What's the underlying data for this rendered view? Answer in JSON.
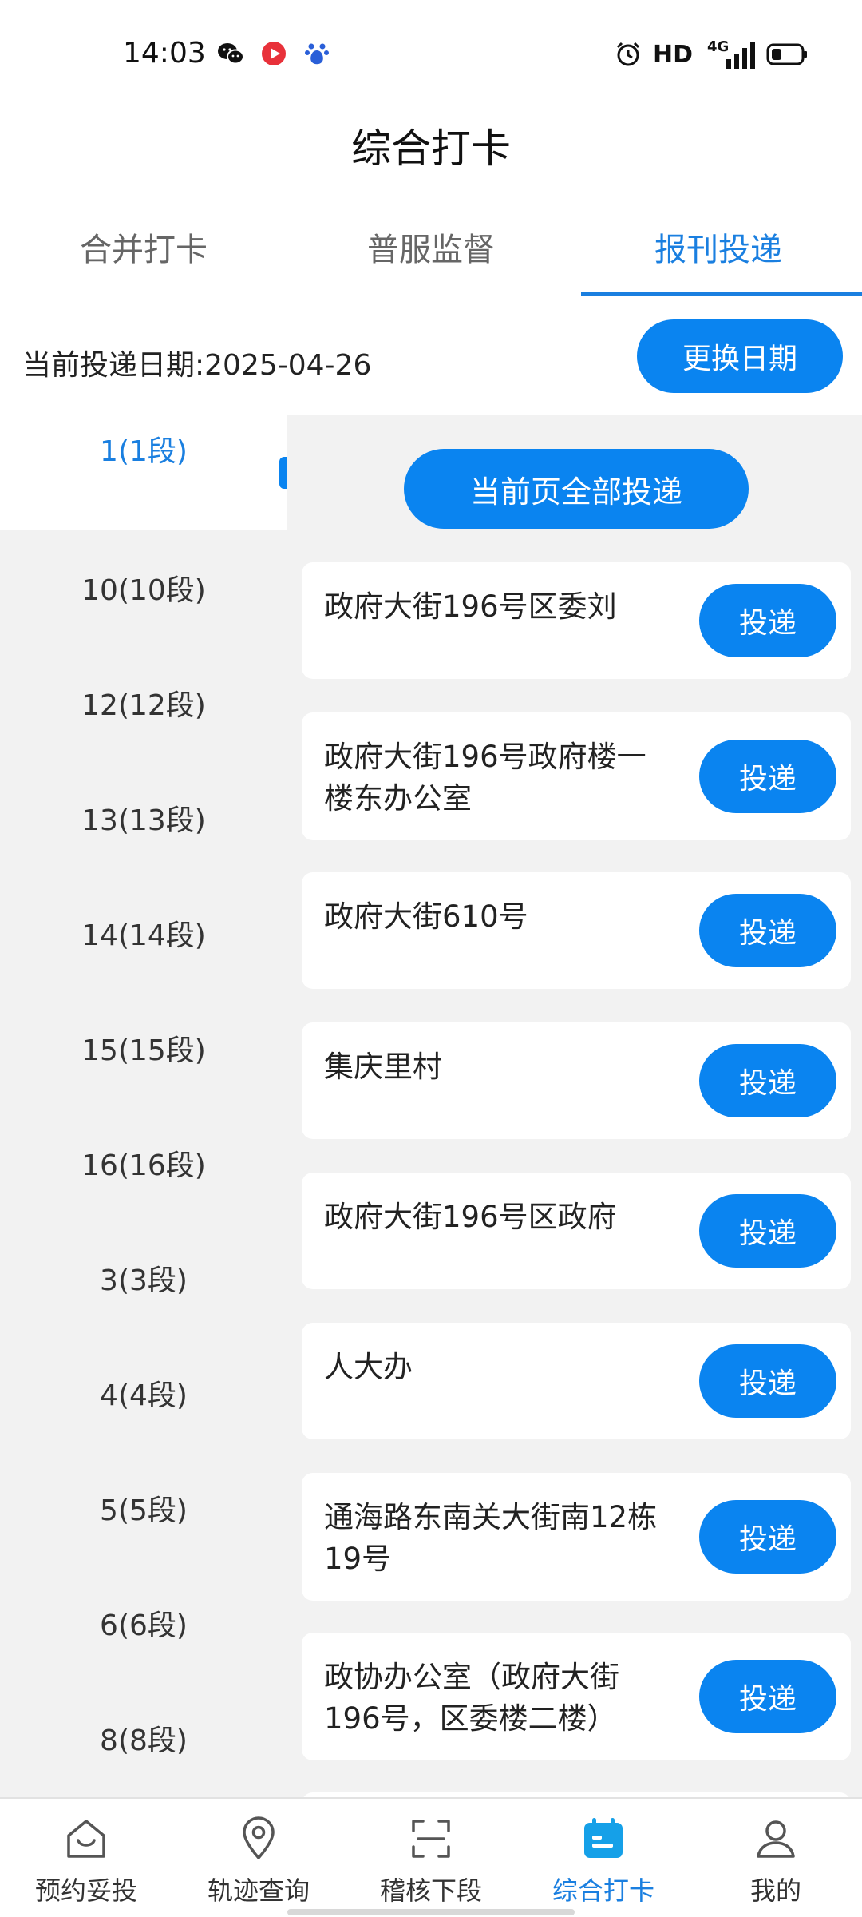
{
  "status_bar": {
    "time": "14:03",
    "hd_label": "HD",
    "network_label": "4G",
    "icons": [
      "wechat-icon",
      "video-app-icon",
      "baidu-icon",
      "alarm-icon",
      "signal-icon",
      "battery-icon"
    ]
  },
  "header": {
    "title": "综合打卡"
  },
  "tabs": [
    {
      "label": "合并打卡"
    },
    {
      "label": "普服监督"
    },
    {
      "label": "报刊投递"
    }
  ],
  "active_tab": 2,
  "date_row": {
    "date_text": "当前投递日期:2025-04-26",
    "change_date_label": "更换日期"
  },
  "segments": [
    {
      "label": "1(1段)"
    },
    {
      "label": "10(10段)"
    },
    {
      "label": "12(12段)"
    },
    {
      "label": "13(13段)"
    },
    {
      "label": "14(14段)"
    },
    {
      "label": "15(15段)"
    },
    {
      "label": "16(16段)"
    },
    {
      "label": "3(3段)"
    },
    {
      "label": "4(4段)"
    },
    {
      "label": "5(5段)"
    },
    {
      "label": "6(6段)"
    },
    {
      "label": "8(8段)"
    }
  ],
  "main": {
    "all_deliver_label": "当前页全部投递",
    "items": [
      {
        "address": "政府大街196号区委刘",
        "button": "投递"
      },
      {
        "address": "政府大街196号政府楼一楼东办公室",
        "button": "投递"
      },
      {
        "address": "政府大街610号",
        "button": "投递"
      },
      {
        "address": "集庆里村",
        "button": "投递"
      },
      {
        "address": "政府大街196号区政府",
        "button": "投递"
      },
      {
        "address": "人大办",
        "button": "投递"
      },
      {
        "address": "通海路东南关大街南12栋19号",
        "button": "投递"
      },
      {
        "address": "政协办公室（政府大街196号，区委楼二楼）",
        "button": "投递"
      }
    ]
  },
  "bottom_nav": [
    {
      "label": "预约妥投",
      "icon": "home-bag-icon"
    },
    {
      "label": "轨迹查询",
      "icon": "location-pin-icon"
    },
    {
      "label": "稽核下段",
      "icon": "scan-icon"
    },
    {
      "label": "综合打卡",
      "icon": "calendar-icon"
    },
    {
      "label": "我的",
      "icon": "user-icon"
    }
  ],
  "colors": {
    "accent": "#0a84f0",
    "active_text": "#1a7fe0",
    "panel_bg": "#f2f2f2"
  }
}
